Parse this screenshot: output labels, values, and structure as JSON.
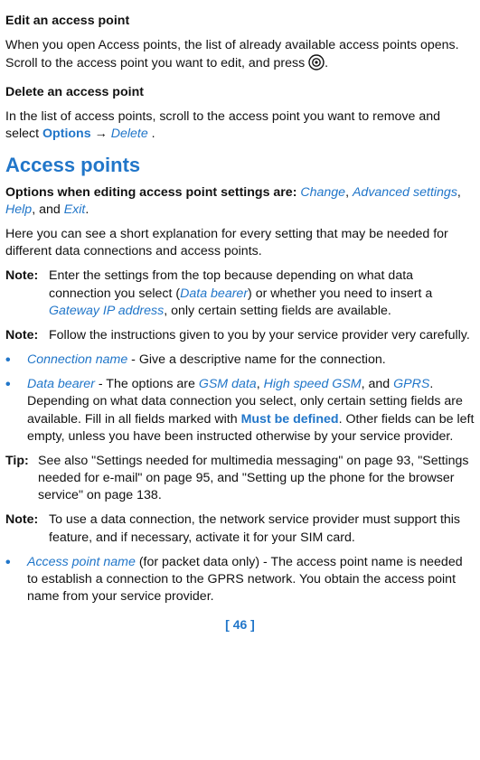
{
  "headings": {
    "editAP": "Edit an access point",
    "deleteAP": "Delete an access point",
    "accessPoints": "Access points"
  },
  "paras": {
    "editIntro1": "When you open Access points, the list of already available access points opens. Scroll to the access point you want to edit, and press ",
    "editIntro2": ".",
    "deleteIntro1": "In the list of access points, scroll to the access point you want to remove and select ",
    "optionsWord": "Options",
    "arrow": "→",
    "deleteWord": "Delete",
    "period": ".",
    "optsIntro1": "Options when editing access point settings are: ",
    "optChange": "Change",
    "comma": ", ",
    "optAdvanced": "Advanced settings",
    "optHelp": "Help",
    "andWord": ", and ",
    "optExit": "Exit",
    "explain": "Here you can see a short explanation for every setting that may be needed for different data connections and access points.",
    "note1a": "Enter the settings from the top because depending on what data connection you select (",
    "dataBearer": "Data bearer",
    "note1b": ") or whether you need to insert a ",
    "gatewayIP": "Gateway IP address",
    "note1c": ", only certain setting fields are available.",
    "note2": "Follow the instructions given to you by your service provider very carefully.",
    "bullet1a": "Connection name",
    "bullet1b": " - Give a descriptive name for the connection.",
    "bullet2a": "Data bearer",
    "bullet2b": " - The options are ",
    "gsmData": "GSM data",
    "hsGSM": "High speed GSM",
    "gprs": "GPRS",
    "bullet2c": ". Depending on what data connection you select, only certain setting fields are available. Fill in all fields marked with ",
    "mustDef": "Must be defined",
    "bullet2d": ". Other fields can be left empty, unless you have been instructed otherwise by your service provider.",
    "tip": "See also \"Settings needed for multimedia messaging\" on page 93, \"Settings needed for e-mail\" on page 95, and \"Setting up the phone for the browser service\" on page 138.",
    "note3": "To use a data connection, the network service provider must support this feature, and if necessary, activate it for your SIM card.",
    "bullet3a": "Access point name",
    "bullet3b": " (for packet data only) - The access point name is needed to establish a connection to the GPRS network. You obtain the access point name from your service provider."
  },
  "labels": {
    "note": "Note:",
    "tip": "Tip:"
  },
  "footer": {
    "pageNum": "[ 46 ]"
  }
}
